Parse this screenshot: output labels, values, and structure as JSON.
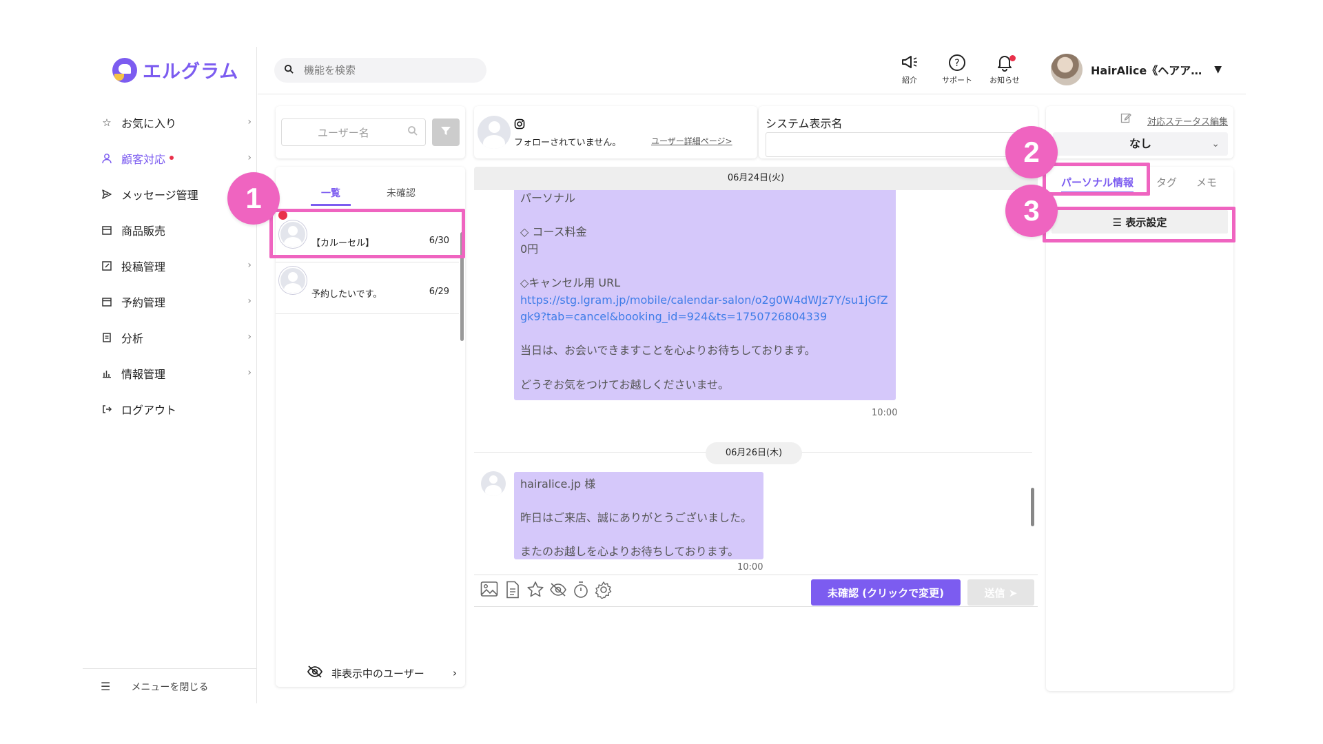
{
  "app": {
    "logo_text": "エルグラム",
    "brand_color": "#7c5cf0",
    "annotation_color": "#ef64c0"
  },
  "header": {
    "search_placeholder": "機能を検索",
    "intro_label": "紹介",
    "support_label": "サポート",
    "news_label": "お知らせ",
    "user_name": "HairAlice《ヘアア…"
  },
  "sidebar": {
    "items": [
      {
        "label": "お気に入り",
        "icon": "star-icon"
      },
      {
        "label": "顧客対応",
        "icon": "person-icon"
      },
      {
        "label": "メッセージ管理",
        "icon": "send-icon"
      },
      {
        "label": "商品販売",
        "icon": "shop-icon"
      },
      {
        "label": "投稿管理",
        "icon": "edit-icon"
      },
      {
        "label": "予約管理",
        "icon": "calendar-icon"
      },
      {
        "label": "分析",
        "icon": "report-icon"
      },
      {
        "label": "情報管理",
        "icon": "bar-chart-icon"
      },
      {
        "label": "ログアウト",
        "icon": "logout-icon"
      }
    ],
    "close_label": "メニューを閉じる"
  },
  "user_list": {
    "search_placeholder": "ユーザー名",
    "tab_all": "一覧",
    "tab_unconfirmed": "未確認",
    "rows": [
      {
        "name": "【カルーセル】",
        "date": "6/30"
      },
      {
        "name": "予約したいです。",
        "date": "6/29"
      }
    ],
    "hidden_users_label": "非表示中のユーザー"
  },
  "chat_header": {
    "follow_status": "フォローされていません。",
    "detail_link": "ユーザー詳細ページ>"
  },
  "system_name": {
    "label": "システム表示名",
    "value": ""
  },
  "chat": {
    "date1": "06月24日(火)",
    "message1": {
      "line1": "パーソナル",
      "line2": "◇ コース料金",
      "line3": "0円",
      "line4": "◇キャンセル用 URL",
      "link": "https://stg.lgram.jp/mobile/calendar-salon/o2g0W4dWJz7Y/su1jGfZgk9?tab=cancel&booking_id=924&ts=1750726804339",
      "line5": "当日は、お会いできますことを心よりお待ちしております。",
      "line6": "どうぞお気をつけてお越しくださいませ。",
      "time": "10:00"
    },
    "date2": "06月26日(木)",
    "message2": {
      "line1": "hairalice.jp 様",
      "line2": "昨日はご来店、誠にありがとうございました。",
      "line3": "またのお越しを心よりお待ちしております。",
      "time": "10:00"
    },
    "unconfirmed_button": "未確認 (クリックで変更)",
    "send_button": "送信"
  },
  "right_panel": {
    "status_edit": "対応ステータス編集",
    "status_value": "なし",
    "tab_personal": "パーソナル情報",
    "tab_tag": "タグ",
    "tab_memo": "メモ",
    "display_settings": "表示設定"
  },
  "annotations": {
    "badge1": "1",
    "badge2": "2",
    "badge3": "3"
  }
}
